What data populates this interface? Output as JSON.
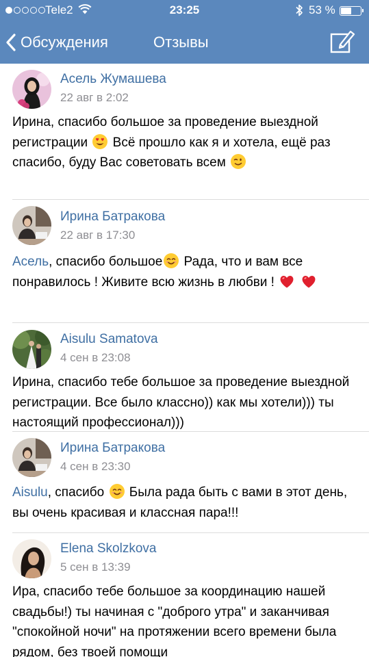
{
  "status_bar": {
    "carrier": "Tele2",
    "time": "23:25",
    "battery_percent": "53 %",
    "battery_level": 0.53,
    "signal_bars_filled": 1,
    "signal_bars_total": 5,
    "icons": [
      "signal-dots-icon",
      "wifi-icon",
      "bluetooth-icon",
      "battery-icon"
    ]
  },
  "nav": {
    "back_label": "Обсуждения",
    "title": "Отзывы",
    "icons": [
      "chevron-left-icon",
      "compose-icon"
    ]
  },
  "colors": {
    "nav_background": "#5b88bd",
    "link": "#3f6fa3",
    "secondary_text": "#8e8e93",
    "divider": "#dcdcdc"
  },
  "comments": [
    {
      "author": "Асель Жумашева",
      "date": "22 авг в 2:02",
      "segments": [
        {
          "text": "Ирина, спасибо большое за проведение выездной регистрации "
        },
        {
          "emoji": "heart-eyes"
        },
        {
          "text": " Всё прошло как я и хотела, ещё раз спасибо, буду Вас советовать всем "
        },
        {
          "emoji": "wink"
        }
      ]
    },
    {
      "author": "Ирина Батракова",
      "date": "22 авг в 17:30",
      "segments": [
        {
          "mention": "Асель"
        },
        {
          "text": ", спасибо большое"
        },
        {
          "emoji": "smile"
        },
        {
          "text": " Рада, что и вам все понравилось ! Живите всю жизнь в любви ! "
        },
        {
          "emoji": "red-heart"
        },
        {
          "text": " "
        },
        {
          "emoji": "red-heart"
        }
      ]
    },
    {
      "author": "Aisulu Samatova",
      "date": "4 сен в 23:08",
      "segments": [
        {
          "text": "Ирина, спасибо тебе большое за проведение выездной регистрации.  Все было классно)) как мы хотели))) ты настоящий профессионал)))"
        }
      ]
    },
    {
      "author": "Ирина Батракова",
      "date": "4 сен в 23:30",
      "segments": [
        {
          "mention": "Aisulu"
        },
        {
          "text": ", спасибо "
        },
        {
          "emoji": "smile"
        },
        {
          "text": " Была рада быть с вами в этот день, вы очень красивая и классная пара!!!"
        }
      ]
    },
    {
      "author": "Elena Skolzkova",
      "date": "5 сен в 13:39",
      "segments": [
        {
          "text": "Ира, спасибо тебе большое за координацию нашей свадьбы!) ты начиная с \"доброго утра\" и заканчивая \"спокойной ночи\" на протяжении всего времени была рядом, без твоей помощи"
        }
      ]
    }
  ]
}
